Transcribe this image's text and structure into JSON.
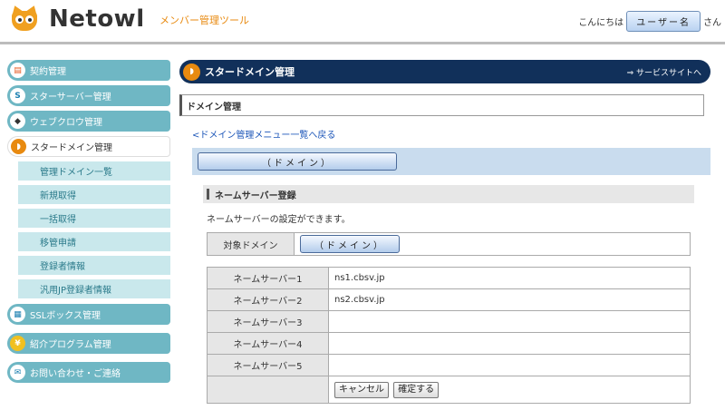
{
  "header": {
    "logo_text": "Netowl",
    "tool_name": "メンバー管理ツール",
    "greeting_prefix": "こんにちは",
    "user_button": "ユーザー名",
    "greeting_suffix": "さん"
  },
  "sidebar": {
    "items": [
      {
        "label": "契約管理",
        "icon": "contract-icon"
      },
      {
        "label": "スターサーバー管理",
        "icon": "star-server-icon"
      },
      {
        "label": "ウェブクロウ管理",
        "icon": "webcrow-icon"
      },
      {
        "label": "スタードメイン管理",
        "icon": "star-domain-icon"
      },
      {
        "label": "SSLボックス管理",
        "icon": "ssl-box-icon"
      },
      {
        "label": "紹介プログラム管理",
        "icon": "referral-icon"
      },
      {
        "label": "お問い合わせ・ご連絡",
        "icon": "contact-icon"
      }
    ],
    "sub_items": [
      "管理ドメイン一覧",
      "新規取得",
      "一括取得",
      "移管申請",
      "登録者情報",
      "汎用JP登録者情報"
    ]
  },
  "main": {
    "title": "スタードメイン管理",
    "service_link": "⇒ サービスサイトへ",
    "box_title": "ドメイン管理",
    "back_link": "<ドメイン管理メニュー一覧へ戻る",
    "domain_button": "（ドメイン）",
    "section": {
      "title": "ネームサーバー登録",
      "description": "ネームサーバーの設定ができます。",
      "target_label": "対象ドメイン",
      "target_button": "（ドメイン）",
      "rows": [
        {
          "label": "ネームサーバー1",
          "value": "ns1.cbsv.jp"
        },
        {
          "label": "ネームサーバー2",
          "value": "ns2.cbsv.jp"
        },
        {
          "label": "ネームサーバー3",
          "value": ""
        },
        {
          "label": "ネームサーバー4",
          "value": ""
        },
        {
          "label": "ネームサーバー5",
          "value": ""
        }
      ],
      "cancel_label": "キャンセル",
      "confirm_label": "確定する"
    }
  },
  "colors": {
    "accent_orange": "#e88a10",
    "nav_teal": "#6fb7c4",
    "title_navy": "#11305a",
    "sub_nav_bg": "#c9e8ec"
  }
}
